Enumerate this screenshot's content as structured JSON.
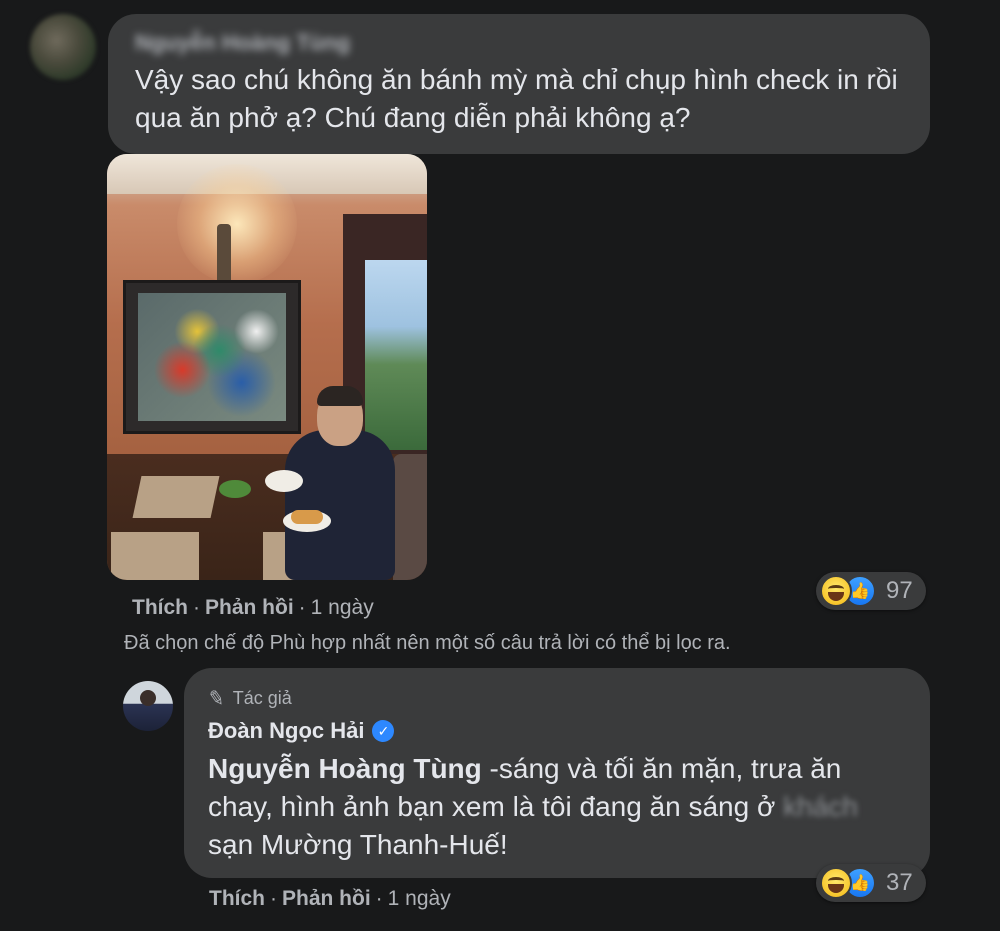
{
  "comment1": {
    "author": "Nguyễn Hoàng Tùng",
    "text": "Vậy sao chú không ăn bánh mỳ mà chỉ chụp hình check in rồi qua ăn phở ạ? Chú đang diễn phải không ạ?",
    "actions": {
      "like": "Thích",
      "reply": "Phản hồi",
      "time": "1 ngày",
      "separator": "·"
    },
    "reactions": {
      "types": [
        "haha-icon",
        "like-icon"
      ],
      "count": "97"
    }
  },
  "filter_notice": "Đã chọn chế độ Phù hợp nhất nên một số câu trả lời có thể bị lọc ra.",
  "reply1": {
    "role_label": "Tác giả",
    "author": "Đoàn Ngọc Hải",
    "mention": "Nguyễn Hoàng Tùng",
    "text_part1": " -sáng và tối ăn mặn, trưa ăn chay, hình ảnh bạn xem là tôi đang ăn sáng ở ",
    "text_blurred": "khách",
    "text_part2": " sạn Mường Thanh-Huế!",
    "actions": {
      "like": "Thích",
      "reply": "Phản hồi",
      "time": "1 ngày",
      "separator": "·"
    },
    "reactions": {
      "types": [
        "haha-icon",
        "like-icon"
      ],
      "count": "37"
    }
  },
  "colors": {
    "background": "#18191a",
    "bubble": "#3a3b3c",
    "text_primary": "#e4e6eb",
    "text_secondary": "#b0b3b8",
    "verified_blue": "#2d88ff",
    "like_blue": "#1877f2"
  }
}
